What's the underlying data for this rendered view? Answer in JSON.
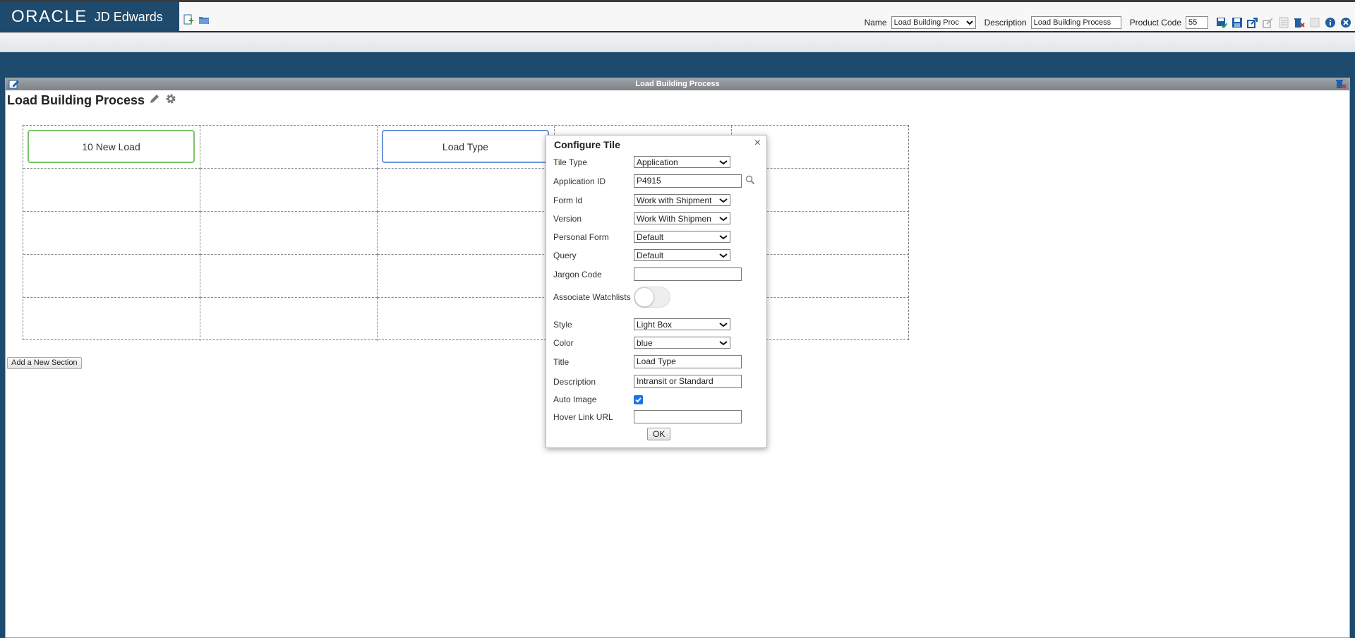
{
  "header": {
    "brand_oracle": "ORACLE",
    "brand_product": "JD Edwards",
    "name_label": "Name",
    "name_value": "Load Building Proc",
    "description_label": "Description",
    "description_value": "Load Building Process",
    "product_code_label": "Product Code",
    "product_code_value": "55",
    "icons": [
      "add-page-icon",
      "open-folder-icon",
      "save-check-icon",
      "save-icon",
      "share-icon",
      "request-publish-icon",
      "delete-icon",
      "note-icon",
      "delete-page-icon",
      "info-icon",
      "close-icon"
    ]
  },
  "panel": {
    "title_bar": "Load Building Process",
    "page_title": "Load Building Process"
  },
  "tiles": {
    "tile1": "10 New Load",
    "tile2": "Load Type"
  },
  "add_section_label": "Add a New Section",
  "dialog": {
    "title": "Configure Tile",
    "close": "×",
    "fields": {
      "tile_type": {
        "label": "Tile Type",
        "value": "Application"
      },
      "application_id": {
        "label": "Application ID",
        "value": "P4915"
      },
      "form_id": {
        "label": "Form Id",
        "value": "Work with Shipment"
      },
      "version": {
        "label": "Version",
        "value": "Work With Shipmen"
      },
      "personal_form": {
        "label": "Personal Form",
        "value": "Default"
      },
      "query": {
        "label": "Query",
        "value": "Default"
      },
      "jargon_code": {
        "label": "Jargon Code",
        "value": ""
      },
      "associate_watchlists": {
        "label": "Associate Watchlists",
        "on": false
      },
      "style": {
        "label": "Style",
        "value": "Light Box"
      },
      "color": {
        "label": "Color",
        "value": "blue"
      },
      "title": {
        "label": "Title",
        "value": "Load Type"
      },
      "description": {
        "label": "Description",
        "value": "Intransit or Standard"
      },
      "auto_image": {
        "label": "Auto Image",
        "checked": true
      },
      "hover_link_url": {
        "label": "Hover Link URL",
        "value": ""
      }
    },
    "ok_label": "OK"
  },
  "colors": {
    "brand_blue": "#1e4a6d",
    "tile_green": "#7cc36b",
    "tile_blue": "#6b94d6",
    "checkbox_blue": "#1a73e8"
  }
}
